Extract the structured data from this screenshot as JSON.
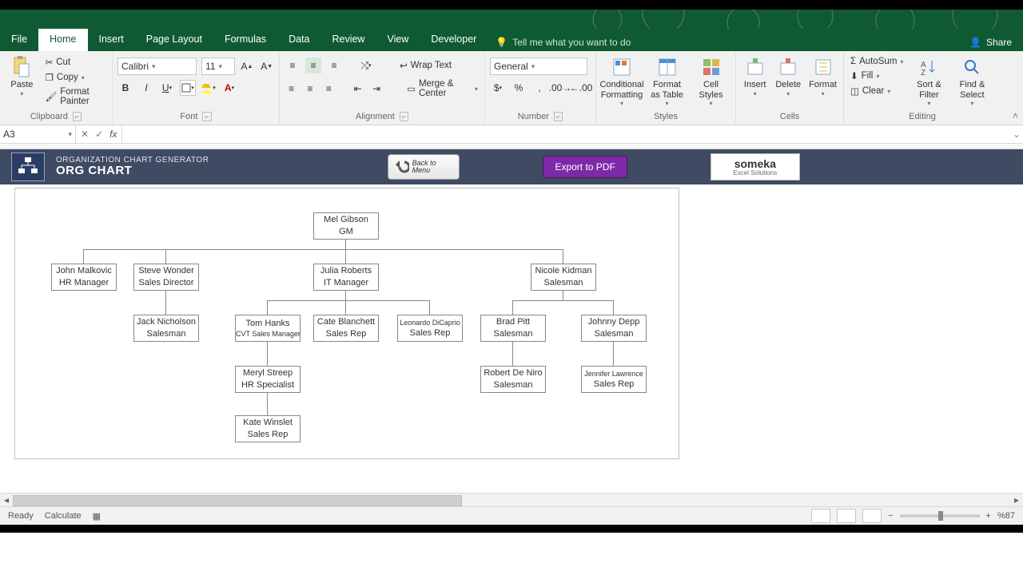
{
  "tabs": {
    "file": "File",
    "home": "Home",
    "insert": "Insert",
    "pagelayout": "Page Layout",
    "formulas": "Formulas",
    "data": "Data",
    "review": "Review",
    "view": "View",
    "developer": "Developer",
    "tellme": "Tell me what you want to do",
    "share": "Share"
  },
  "ribbon": {
    "clipboard": {
      "paste": "Paste",
      "cut": "Cut",
      "copy": "Copy",
      "painter": "Format Painter",
      "label": "Clipboard"
    },
    "font": {
      "name": "Calibri",
      "size": "11",
      "label": "Font"
    },
    "alignment": {
      "wrap": "Wrap Text",
      "merge": "Merge & Center",
      "label": "Alignment"
    },
    "number": {
      "format": "General",
      "label": "Number"
    },
    "styles": {
      "cond": "Conditional Formatting",
      "table": "Format as Table",
      "cell": "Cell Styles",
      "label": "Styles"
    },
    "cells": {
      "insert": "Insert",
      "delete": "Delete",
      "format": "Format",
      "label": "Cells"
    },
    "editing": {
      "autosum": "AutoSum",
      "fill": "Fill",
      "clear": "Clear",
      "sort": "Sort & Filter",
      "find": "Find & Select",
      "label": "Editing"
    }
  },
  "namebox": "A3",
  "header": {
    "subtitle": "ORGANIZATION CHART GENERATOR",
    "title": "ORG CHART",
    "back": "Back to Menu",
    "export": "Export to PDF",
    "brand": "someka",
    "brandsub": "Excel Solutions"
  },
  "chart_data": {
    "type": "org-chart",
    "nodes": [
      {
        "id": "n0",
        "name": "Mel Gibson",
        "role": "GM",
        "parent": null
      },
      {
        "id": "n1",
        "name": "John Malkovic",
        "role": "HR Manager",
        "parent": "n0"
      },
      {
        "id": "n2",
        "name": "Steve Wonder",
        "role": "Sales Director",
        "parent": "n0"
      },
      {
        "id": "n3",
        "name": "Julia Roberts",
        "role": "IT Manager",
        "parent": "n0"
      },
      {
        "id": "n4",
        "name": "Nicole Kidman",
        "role": "Salesman",
        "parent": "n0"
      },
      {
        "id": "n5",
        "name": "Jack Nicholson",
        "role": "Salesman",
        "parent": "n2"
      },
      {
        "id": "n6",
        "name": "Tom Hanks",
        "role": "CVT Sales Manager",
        "parent": "n3"
      },
      {
        "id": "n7",
        "name": "Cate Blanchett",
        "role": "Sales Rep",
        "parent": "n3"
      },
      {
        "id": "n8",
        "name": "Leonardo DiCaprio",
        "role": "Sales Rep",
        "parent": "n3"
      },
      {
        "id": "n9",
        "name": "Brad Pitt",
        "role": "Salesman",
        "parent": "n4"
      },
      {
        "id": "n10",
        "name": "Johnny Depp",
        "role": "Salesman",
        "parent": "n4"
      },
      {
        "id": "n11",
        "name": "Meryl Streep",
        "role": "HR Specialist",
        "parent": "n6"
      },
      {
        "id": "n12",
        "name": "Robert De Niro",
        "role": "Salesman",
        "parent": "n9"
      },
      {
        "id": "n13",
        "name": "Jennifer Lawrence",
        "role": "Sales Rep",
        "parent": "n10"
      },
      {
        "id": "n14",
        "name": "Kate Winslet",
        "role": "Sales Rep",
        "parent": "n11"
      }
    ]
  },
  "status": {
    "ready": "Ready",
    "calc": "Calculate",
    "zoom": "%87"
  }
}
